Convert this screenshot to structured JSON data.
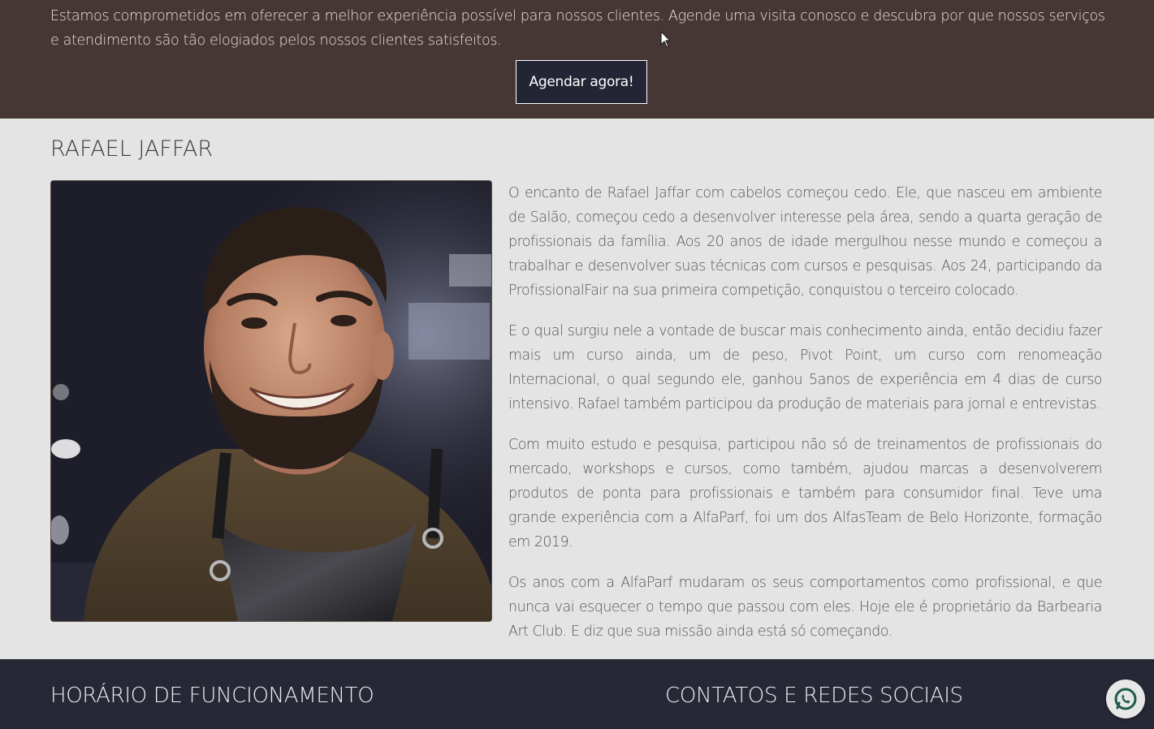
{
  "cta": {
    "text": "Estamos comprometidos em oferecer a melhor experiência possível para nossos clientes. Agende uma visita conosco e descubra por que nossos serviços e atendimento são tão elogiados pelos nossos clientes satisfeitos.",
    "button_label": "Agendar agora!"
  },
  "profile": {
    "title": "RAFAEL JAFFAR",
    "paragraphs": [
      "O encanto de Rafael Jaffar com cabelos começou cedo. Ele, que nasceu em ambiente de Salão, começou cedo a desenvolver interesse pela área, sendo a quarta geração de profissionais da família. Aos 20 anos de idade mergulhou nesse mundo e começou a trabalhar e desenvolver suas técnicas com cursos e pesquisas. Aos 24, participando da ProfissionalFair na sua primeira competição, conquistou o terceiro colocado.",
      "E o qual surgiu nele a vontade de buscar mais conhecimento ainda, então decidiu fazer mais um curso ainda, um de peso, Pivot Point, um curso com renomeação Internacional, o qual segundo ele, ganhou 5anos de experiência em 4 dias de curso intensivo. Rafael também participou da produção de materiais para jornal e entrevistas.",
      "Com muito estudo e pesquisa, participou não só de treinamentos de profissionais do mercado, workshops e cursos, como também, ajudou marcas a desenvolverem produtos de ponta para profissionais e também para consumidor final. Teve uma grande experiência com a AlfaParf, foi um dos AlfasTeam de Belo Horizonte, formação em 2019.",
      "Os anos com a AlfaParf mudaram os seus comportamentos como profissional, e que nunca vai esquecer o tempo que passou com eles. Hoje ele é proprietário da Barbearia Art Club. E diz que sua missão ainda está só começando."
    ]
  },
  "footer": {
    "hours_heading": "HORÁRIO DE FUNCIONAMENTO",
    "contacts_heading": "CONTATOS E REDES SOCIAIS"
  },
  "icons": {
    "whatsapp": "whatsapp-icon",
    "cursor": "mouse-pointer-icon"
  },
  "colors": {
    "cta_band": "#463734",
    "profile_bg": "#e4e4e4",
    "footer_bg": "#262836",
    "button_bg": "#232535"
  }
}
